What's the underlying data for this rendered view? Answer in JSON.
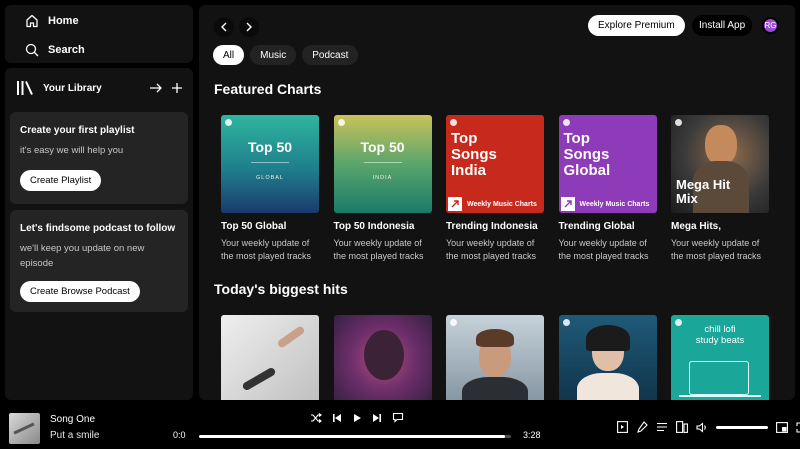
{
  "nav": {
    "home": "Home",
    "search": "Search"
  },
  "library": {
    "title": "Your Library"
  },
  "cards": [
    {
      "title": "Create your first playlist",
      "desc": "it's easy we will help you",
      "button": "Create Playlist"
    },
    {
      "title": "Let's findsome podcast to follow",
      "desc": "we'll keep you update on new episode",
      "button": "Create Browse Podcast"
    }
  ],
  "topbar": {
    "premium": "Explore Premium",
    "install": "Install App",
    "avatar": "RG"
  },
  "chips": [
    "All",
    "Music",
    "Podcast"
  ],
  "sections": {
    "featured": "Featured Charts",
    "hits": "Today's biggest hits"
  },
  "featured": [
    {
      "name": "Top 50 Global",
      "desc": "Your weekly update of the most played tracks",
      "art_big": "Top 50",
      "art_small": "GLOBAL"
    },
    {
      "name": "Top 50 Indonesia",
      "desc": "Your weekly update of the most played tracks",
      "art_big": "Top 50",
      "art_small": "INDIA"
    },
    {
      "name": "Trending Indonesia",
      "desc": "Your weekly update of the most played tracks",
      "art_title": "Top Songs India",
      "art_badge": "Weekly Music Charts"
    },
    {
      "name": "Trending Global",
      "desc": "Your weekly update of the most played tracks",
      "art_title": "Top Songs Global",
      "art_badge": "Weekly Music Charts"
    },
    {
      "name": "Mega Hits,",
      "desc": "Your weekly update of the most played tracks",
      "art_title": "Mega Hit Mix"
    }
  ],
  "hits": [
    {
      "label": ""
    },
    {
      "label": ""
    },
    {
      "label": ""
    },
    {
      "label": ""
    },
    {
      "label": "chill lofi study beats"
    }
  ],
  "player": {
    "song": "Song One",
    "artist": "Put a smile",
    "time_current": "0:0",
    "time_total": "3:28",
    "progress": 0.98
  },
  "colors": {
    "accent": "#9b4bd8",
    "panel": "#121212",
    "card": "#242424"
  }
}
